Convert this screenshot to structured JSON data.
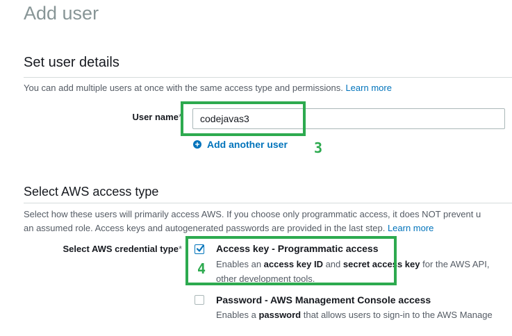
{
  "page": {
    "title": "Add user"
  },
  "user_details": {
    "heading": "Set user details",
    "description": "You can add multiple users at once with the same access type and permissions.",
    "learn_more": "Learn more",
    "user_name_label": "User name",
    "required_mark": "*",
    "user_name_value": "codejavas3",
    "add_another_label": "Add another user",
    "annotation": "3"
  },
  "access_type": {
    "heading": "Select AWS access type",
    "description_line1": "Select how these users will primarily access AWS. If you choose only programmatic access, it does NOT prevent u",
    "description_line2": "an assumed role. Access keys and autogenerated passwords are provided in the last step.",
    "learn_more": "Learn more",
    "credential_label": "Select AWS credential type",
    "required_mark": "*",
    "annotation": "4",
    "options": [
      {
        "title": "Access key - Programmatic access",
        "checked": true,
        "desc_pre": "Enables an ",
        "desc_b1": "access key ID",
        "desc_mid": " and ",
        "desc_b2": "secret access key",
        "desc_post": " for the AWS API,",
        "desc_line2": "other development tools."
      },
      {
        "title": "Password - AWS Management Console access",
        "checked": false,
        "desc_pre": "Enables a ",
        "desc_b1": "password",
        "desc_post": " that allows users to sign-in to the AWS Manage"
      }
    ]
  },
  "colors": {
    "link": "#0073bb",
    "highlight": "#2daa4f",
    "title_gray": "#879596"
  }
}
